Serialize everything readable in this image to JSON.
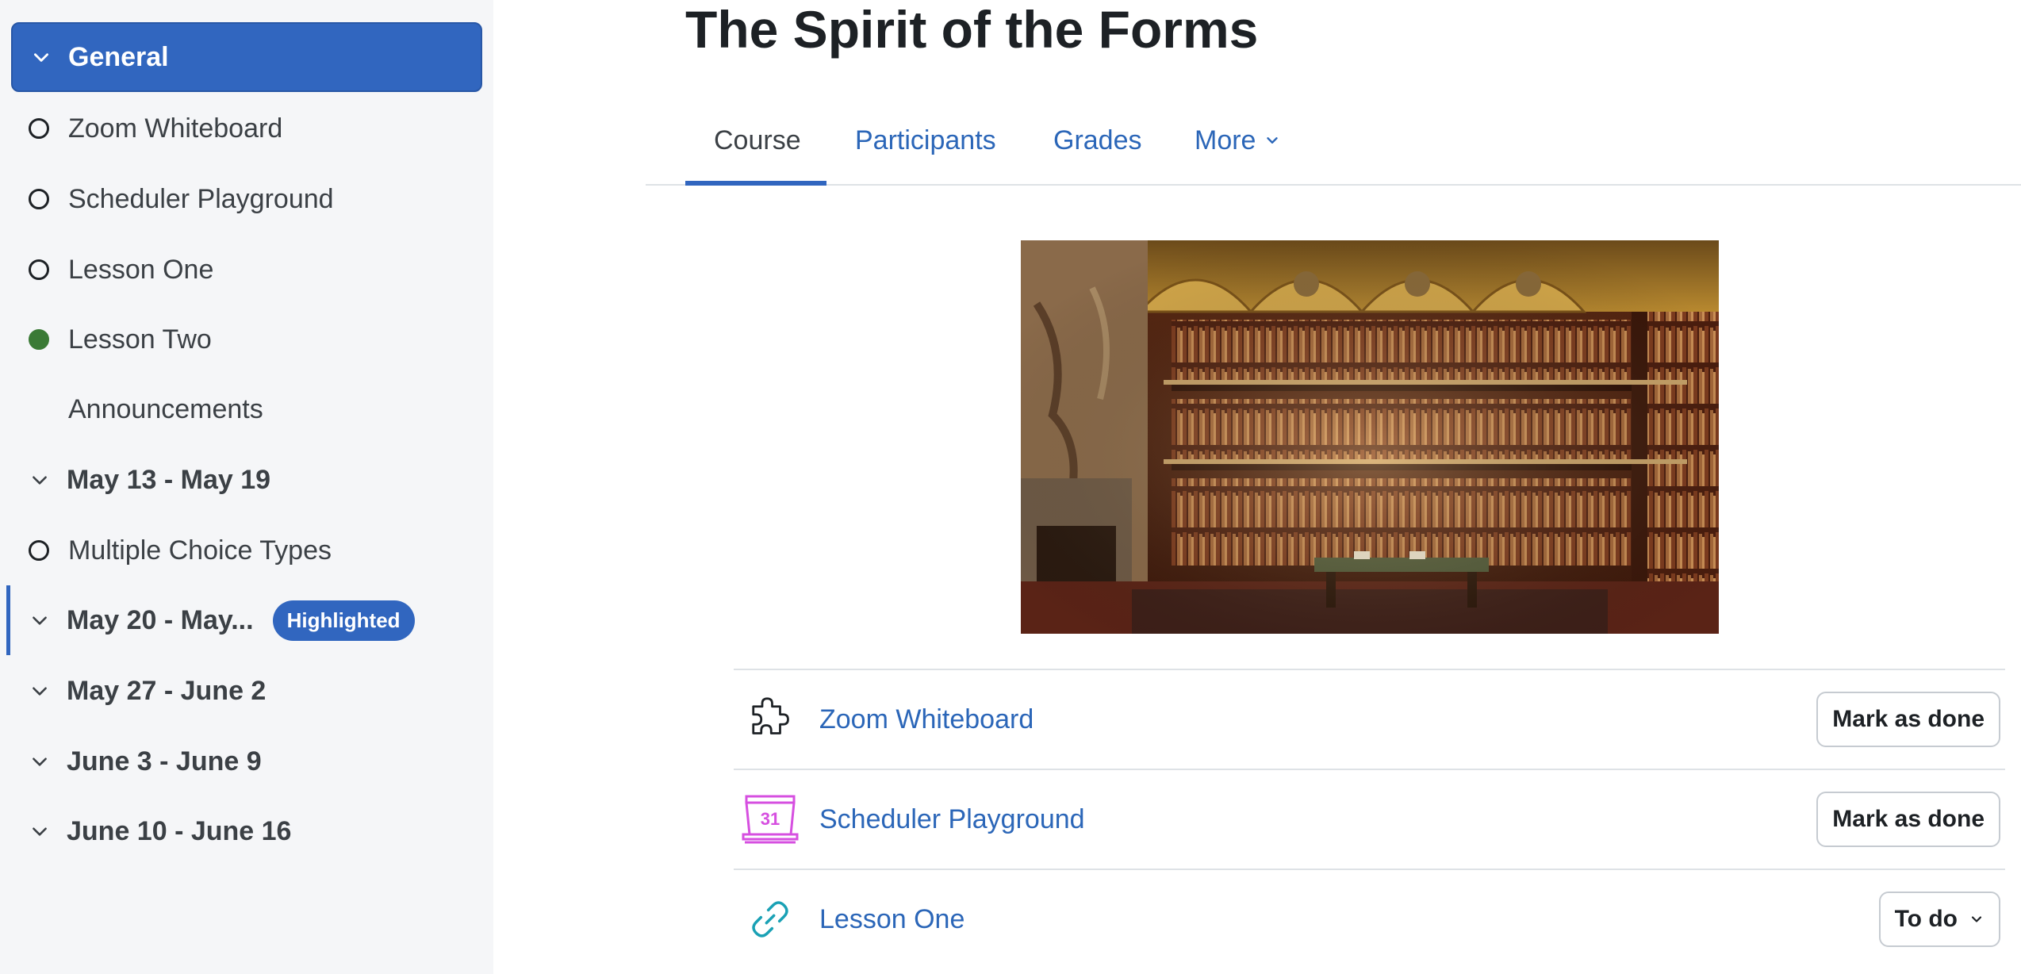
{
  "course_index": {
    "sections": [
      {
        "title": "General",
        "active": true
      },
      {
        "title": "May 13 - May 19"
      },
      {
        "title": "May 20 - May...",
        "badge": "Highlighted"
      },
      {
        "title": "May 27 - June 2"
      },
      {
        "title": "June 3 - June 9"
      },
      {
        "title": "June 10 - June 16"
      }
    ],
    "activities": [
      {
        "title": "Zoom Whiteboard",
        "status": "incomplete"
      },
      {
        "title": "Scheduler Playground",
        "status": "incomplete"
      },
      {
        "title": "Lesson One",
        "status": "incomplete"
      },
      {
        "title": "Lesson Two",
        "status": "complete"
      },
      {
        "title": "Announcements",
        "status": "none"
      },
      {
        "title": "Multiple Choice Types",
        "status": "incomplete"
      }
    ]
  },
  "page": {
    "title": "The Spirit of the Forms"
  },
  "tabs": [
    {
      "label": "Course",
      "current": true
    },
    {
      "label": "Participants"
    },
    {
      "label": "Grades"
    },
    {
      "label": "More"
    }
  ],
  "course_activities": [
    {
      "name": "Zoom Whiteboard",
      "icon": "puzzle-icon",
      "button": "Mark as done"
    },
    {
      "name": "Scheduler Playground",
      "icon": "calendar-icon",
      "icon_text": "31",
      "button": "Mark as done"
    },
    {
      "name": "Lesson One",
      "icon": "link-icon",
      "button": "To do"
    }
  ],
  "colors": {
    "primary": "#3166bf",
    "link": "#2b66b8",
    "complete": "#3a7a35",
    "scheduler_icon": "#d64fe0",
    "url_icon": "#1aa1b5"
  }
}
